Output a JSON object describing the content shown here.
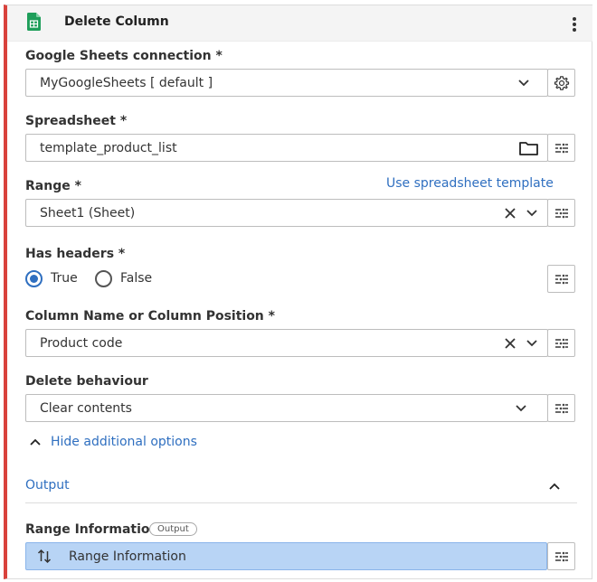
{
  "panel": {
    "title": "Delete Column",
    "accent_color": "#d9423c",
    "icons": {
      "app": "google-sheets-icon",
      "menu": "kebab-menu-icon"
    }
  },
  "form": {
    "connection": {
      "label": "Google Sheets connection *",
      "value": "MyGoogleSheets [ default ]",
      "icons": [
        "chevron-down-icon",
        "gear-icon"
      ]
    },
    "spreadsheet": {
      "label": "Spreadsheet *",
      "value": "template_product_list",
      "icons": [
        "folder-icon",
        "mapping-icon"
      ]
    },
    "range": {
      "label": "Range *",
      "link": "Use spreadsheet template",
      "value": "Sheet1 (Sheet)",
      "icons": [
        "clear-icon",
        "chevron-down-icon",
        "mapping-icon"
      ]
    },
    "has_headers": {
      "label": "Has headers *",
      "options": [
        {
          "label": "True",
          "checked": true
        },
        {
          "label": "False",
          "checked": false
        }
      ]
    },
    "column": {
      "label": "Column Name or Column Position *",
      "value": "Product code",
      "icons": [
        "clear-icon",
        "chevron-down-icon",
        "mapping-icon"
      ]
    },
    "delete_behaviour": {
      "label": "Delete behaviour",
      "value": "Clear contents",
      "icons": [
        "chevron-down-icon",
        "mapping-icon"
      ]
    },
    "toggle_options": "Hide additional options"
  },
  "output": {
    "section_title": "Output",
    "field_label": "Range Information",
    "badge": "Output",
    "value": "Range Information",
    "highlight_color": "#b8d4f5"
  },
  "colors": {
    "link": "#2f6fc0",
    "border": "#bdbdbd"
  }
}
